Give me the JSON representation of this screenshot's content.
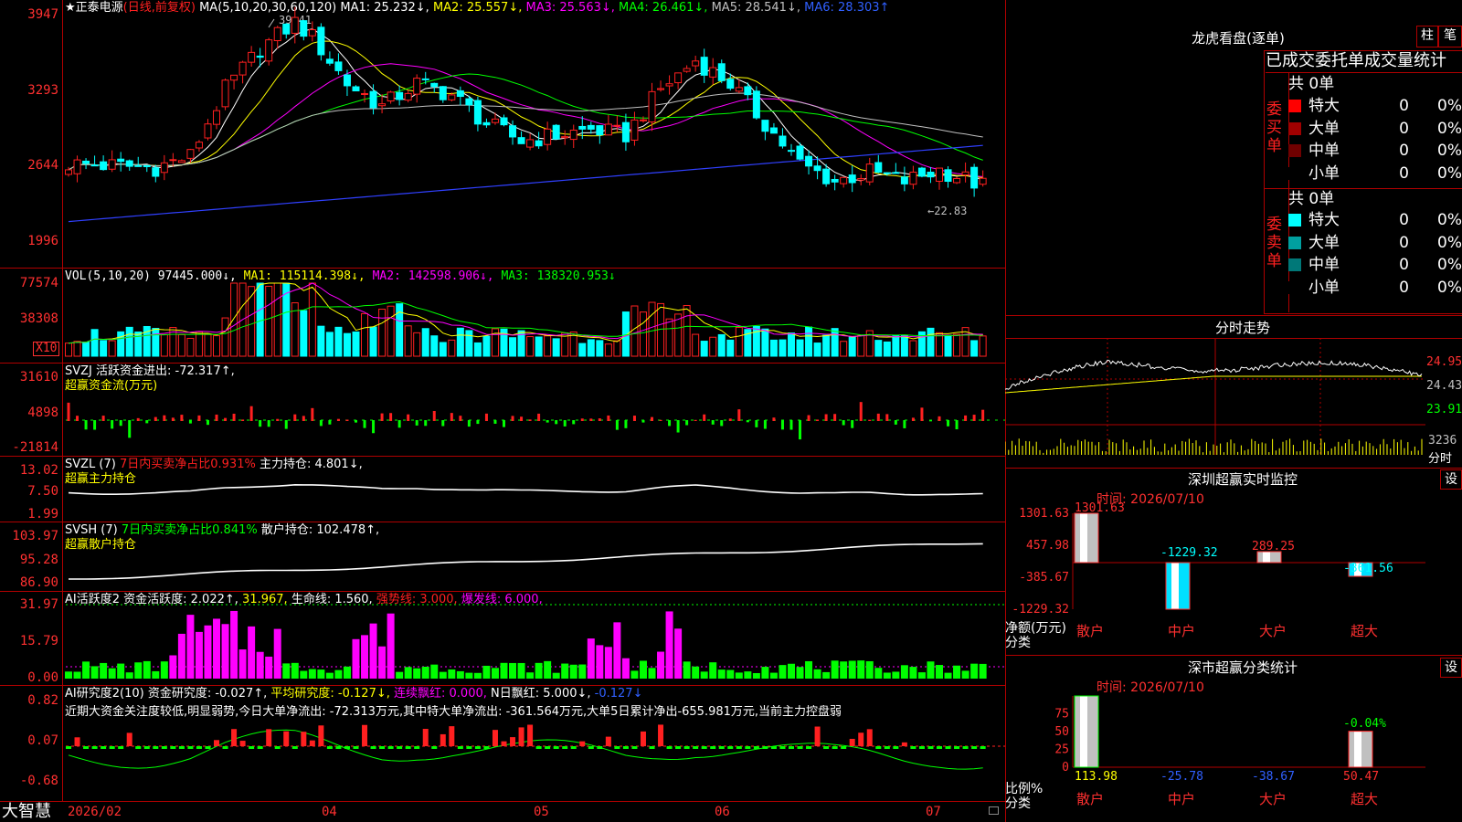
{
  "app": {
    "brand": "大智慧"
  },
  "kline": {
    "stock_title": "★正泰电源",
    "period_label": "(日线,前复权)",
    "ma_params": "MA(5,10,20,30,60,120)",
    "ma1": "MA1: 25.232↓,",
    "ma2": "MA2: 25.557↓,",
    "ma3": "MA3: 25.563↓,",
    "ma4": "MA4: 26.461↓,",
    "ma5": "MA5: 28.541↓,",
    "ma6": "MA6: 28.303↑",
    "y_labels": [
      "3947",
      "3293",
      "2644",
      "1996"
    ],
    "high_mark": "39.41",
    "low_mark": "←22.83"
  },
  "vol": {
    "label": "VOL(5,10,20)",
    "value": "97445.000↓,",
    "ma1": "MA1: 115114.398↓,",
    "ma2": "MA2: 142598.906↓,",
    "ma3": "MA3: 138320.953↓",
    "y_labels": [
      "77574",
      "38308"
    ],
    "unit": "X10"
  },
  "svzj": {
    "label": "SVZJ",
    "desc": "活跃资金进出: -72.317↑,",
    "sub": "超赢资金流(万元)",
    "y_labels": [
      "31610",
      "4898",
      "-21814"
    ]
  },
  "svzl": {
    "label": "SVZL (7)",
    "desc": "7日内买卖净占比0.931%",
    "hold": "主力持仓: 4.801↓,",
    "sub": "超赢主力持仓",
    "y_labels": [
      "13.02",
      "7.50",
      "1.99"
    ]
  },
  "svsh": {
    "label": "SVSH (7)",
    "desc": "7日内买卖净占比0.841%",
    "hold": "散户持仓: 102.478↑,",
    "sub": "超赢散户持仓",
    "y_labels": [
      "103.97",
      "95.28",
      "86.90"
    ]
  },
  "ai_active": {
    "label": "AI活跃度2",
    "v1": "资金活跃度: 2.022↑,",
    "v2": "31.967,",
    "v3": "生命线: 1.560,",
    "v4": "强势线: 3.000,",
    "v5": "爆发线: 6.000,",
    "y_labels": [
      "31.97",
      "15.79",
      "0.00"
    ]
  },
  "ai_research": {
    "label": "AI研究度2(10)",
    "v1": "资金研究度: -0.027↑,",
    "v2": "平均研究度: -0.127↓,",
    "v3": "连续飘红: 0.000,",
    "v4": "N日飘红: 5.000↓,",
    "v5": "-0.127↓",
    "note": "近期大资金关注度较低,明显弱势,今日大单净流出: -72.313万元,其中特大单净流出: -361.564万元,大单5日累计净出-655.981万元,当前主力控盘弱",
    "y_labels": [
      "0.82",
      "0.07",
      "-0.68"
    ]
  },
  "xaxis": [
    "2026/02",
    "04",
    "05",
    "06",
    "07"
  ],
  "right": {
    "lhb_title": "龙虎看盘(逐单)",
    "btn_zhu": "柱",
    "btn_bi": "笔",
    "order_title": "已成交委托单成交量统计",
    "buy_label": "委买单",
    "sell_label": "委卖单",
    "buy_total": "共 0单",
    "sell_total": "共 0单",
    "buy_rows": [
      {
        "name": "特大",
        "cnt": "0",
        "pct": "0%",
        "color": "#ff0000"
      },
      {
        "name": "大单",
        "cnt": "0",
        "pct": "0%",
        "color": "#a00000"
      },
      {
        "name": "中单",
        "cnt": "0",
        "pct": "0%",
        "color": "#700000"
      },
      {
        "name": "小单",
        "cnt": "0",
        "pct": "0%",
        "color": "#000000"
      }
    ],
    "sell_rows": [
      {
        "name": "特大",
        "cnt": "0",
        "pct": "0%",
        "color": "#00ffff"
      },
      {
        "name": "大单",
        "cnt": "0",
        "pct": "0%",
        "color": "#00a0a0"
      },
      {
        "name": "中单",
        "cnt": "0",
        "pct": "0%",
        "color": "#007878"
      },
      {
        "name": "小单",
        "cnt": "0",
        "pct": "0%",
        "color": "#000000"
      }
    ],
    "intraday_title": "分时走势",
    "intraday_prices": [
      "24.95",
      "24.43",
      "23.91"
    ],
    "intraday_vol": "3236",
    "intraday_tag": "分时",
    "monitor_title": "深圳超赢实时监控",
    "monitor_set": "设",
    "monitor_time": "时间: 2026/07/10",
    "monitor_y": [
      "1301.63",
      "457.98",
      "-385.67",
      "-1229.32"
    ],
    "monitor_unit": "净额(万元)",
    "monitor_cat": "分类",
    "stats_title": "深市超赢分类统计",
    "stats_set": "设",
    "stats_time": "时间: 2026/07/10",
    "stats_y": [
      "75",
      "50",
      "25",
      "0"
    ],
    "stats_unit": "比例%",
    "stats_cat": "分类"
  },
  "chart_data": [
    {
      "type": "bar",
      "title": "深圳超赢实时监控",
      "ylabel": "净额(万元)",
      "categories": [
        "散户",
        "中户",
        "大户",
        "超大"
      ],
      "values": [
        1301.63,
        -1229.32,
        289.25,
        -361.56
      ],
      "ylim": [
        -1229.32,
        1301.63
      ]
    },
    {
      "type": "bar",
      "title": "深市超赢分类统计",
      "ylabel": "比例%",
      "categories": [
        "散户",
        "中户",
        "大户",
        "超大"
      ],
      "values": [
        113.98,
        -25.78,
        -38.67,
        50.47
      ],
      "bar_label": "-0.04%",
      "ylim": [
        0,
        100
      ]
    }
  ]
}
